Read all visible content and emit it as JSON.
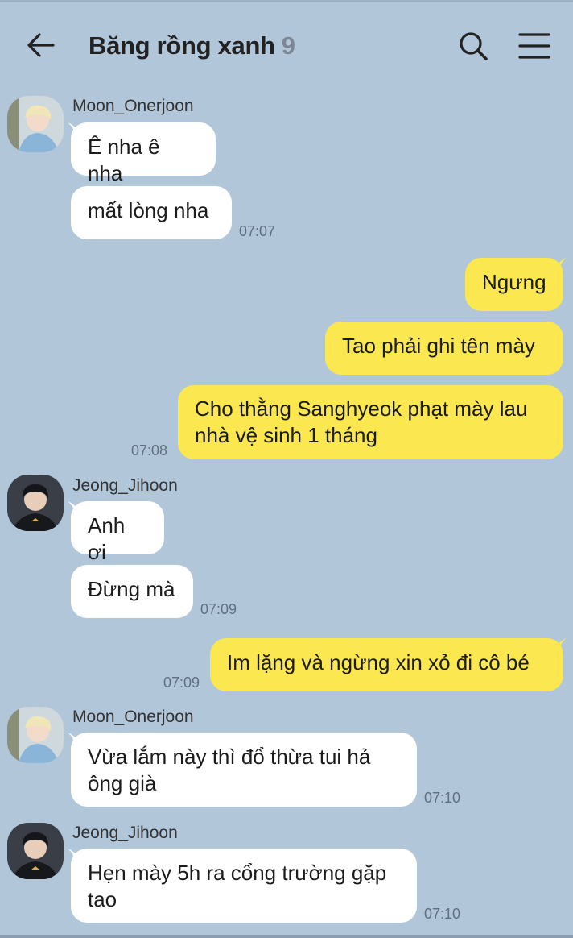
{
  "header": {
    "title": "Băng rồng xanh",
    "member_count": "9",
    "icons": [
      "back-arrow-icon",
      "search-icon",
      "menu-icon"
    ]
  },
  "colors": {
    "background": "#b2c6da",
    "incoming_bubble": "#ffffff",
    "outgoing_bubble": "#fbe74f"
  },
  "messages": [
    {
      "sender": "Moon_Onerjoon",
      "text": "Ê nha ê nha"
    },
    {
      "text": "mất lòng nha",
      "time": "07:07"
    },
    {
      "text": "Ngưng"
    },
    {
      "text": "Tao phải ghi tên mày"
    },
    {
      "text": "Cho thằng Sanghyeok phạt mày lau nhà vệ sinh 1 tháng",
      "time": "07:08"
    },
    {
      "sender": "Jeong_Jihoon",
      "text": "Anh ơi"
    },
    {
      "text": "Đừng mà",
      "time": "07:09"
    },
    {
      "text": "Im lặng và ngừng xin xỏ đi cô bé",
      "time": "07:09"
    },
    {
      "sender": "Moon_Onerjoon",
      "text": "Vừa lắm này thì đổ thừa tui hả ông già",
      "time": "07:10"
    },
    {
      "sender": "Jeong_Jihoon",
      "text": "Hẹn mày 5h ra cổng trường gặp tao",
      "time": "07:10"
    }
  ]
}
